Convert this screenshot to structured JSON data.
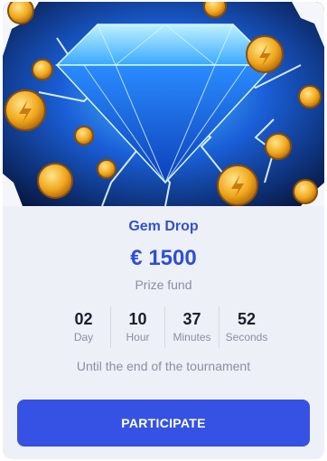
{
  "hero": {
    "image_icon": "diamond-lightning-coins-illustration"
  },
  "tournament": {
    "title": "Gem Drop",
    "prize_amount": "€ 1500",
    "prize_label": "Prize fund"
  },
  "timer": {
    "days": "02",
    "days_label": "Day",
    "hours": "10",
    "hours_label": "Hour",
    "minutes": "37",
    "minutes_label": "Minutes",
    "seconds": "52",
    "seconds_label": "Seconds"
  },
  "until_text": "Until the end of the tournament",
  "participate_label": "PARTICIPATE",
  "colors": {
    "accent": "#3552e4",
    "title": "#3352c9",
    "card_bg": "#eef0f8",
    "muted_text": "#8a8fa0"
  }
}
